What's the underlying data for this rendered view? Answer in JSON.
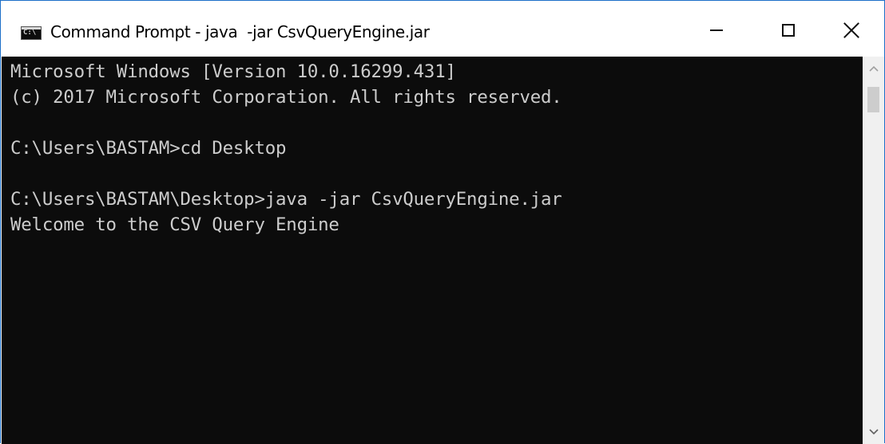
{
  "window": {
    "title": "Command Prompt - java  -jar CsvQueryEngine.jar",
    "icon": "C:\\",
    "controls": {
      "minimize": "minimize-icon",
      "maximize": "maximize-icon",
      "close": "close-icon"
    }
  },
  "console": {
    "lines": [
      "Microsoft Windows [Version 10.0.16299.431]",
      "(c) 2017 Microsoft Corporation. All rights reserved.",
      "",
      "C:\\Users\\BASTAM>cd Desktop",
      "",
      "C:\\Users\\BASTAM\\Desktop>java -jar CsvQueryEngine.jar",
      "Welcome to the CSV Query Engine"
    ],
    "background": "#0c0c0c",
    "foreground": "#cccccc"
  },
  "scrollbar": {
    "up_arrow": "chevron-up-icon",
    "down_arrow": "chevron-down-icon"
  }
}
